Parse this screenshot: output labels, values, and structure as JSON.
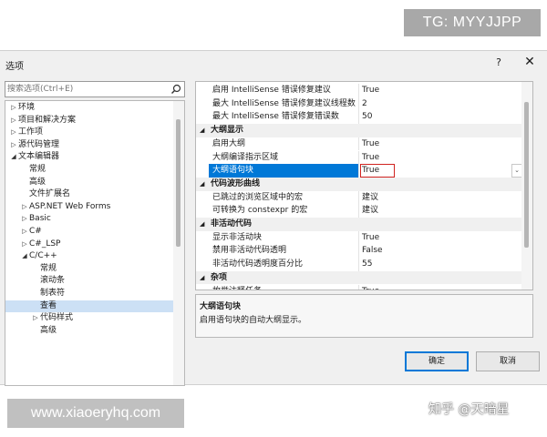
{
  "dialog": {
    "title": "选项",
    "help": "?",
    "close": "✕"
  },
  "search": {
    "placeholder": "搜索选项(Ctrl+E)",
    "value": ""
  },
  "tree": [
    {
      "label": "环境",
      "expander": "▷",
      "indent": 0
    },
    {
      "label": "项目和解决方案",
      "expander": "▷",
      "indent": 0
    },
    {
      "label": "工作项",
      "expander": "▷",
      "indent": 0
    },
    {
      "label": "源代码管理",
      "expander": "▷",
      "indent": 0
    },
    {
      "label": "文本编辑器",
      "expander": "◢",
      "indent": 0
    },
    {
      "label": "常规",
      "expander": "",
      "indent": 1
    },
    {
      "label": "高级",
      "expander": "",
      "indent": 1
    },
    {
      "label": "文件扩展名",
      "expander": "",
      "indent": 1
    },
    {
      "label": "ASP.NET Web Forms",
      "expander": "▷",
      "indent": 1
    },
    {
      "label": "Basic",
      "expander": "▷",
      "indent": 1
    },
    {
      "label": "C#",
      "expander": "▷",
      "indent": 1
    },
    {
      "label": "C#_LSP",
      "expander": "▷",
      "indent": 1
    },
    {
      "label": "C/C++",
      "expander": "◢",
      "indent": 1
    },
    {
      "label": "常规",
      "expander": "",
      "indent": 2
    },
    {
      "label": "滚动条",
      "expander": "",
      "indent": 2
    },
    {
      "label": "制表符",
      "expander": "",
      "indent": 2
    },
    {
      "label": "查看",
      "expander": "",
      "indent": 2,
      "selected": true
    },
    {
      "label": "代码样式",
      "expander": "▷",
      "indent": 2
    },
    {
      "label": "高级",
      "expander": "",
      "indent": 2
    }
  ],
  "properties": [
    {
      "kind": "prop",
      "name": "启用 IntelliSense 错误修复建议",
      "value": "True"
    },
    {
      "kind": "prop",
      "name": "最大 IntelliSense 错误修复建议线程数",
      "value": "2"
    },
    {
      "kind": "prop",
      "name": "最大 IntelliSense 错误修复错误数",
      "value": "50"
    },
    {
      "kind": "cat",
      "name": "大纲显示",
      "chevron": "◢"
    },
    {
      "kind": "prop",
      "name": "启用大纲",
      "value": "True"
    },
    {
      "kind": "prop",
      "name": "大纲编译指示区域",
      "value": "True"
    },
    {
      "kind": "prop",
      "name": "大纲语句块",
      "value": "True",
      "selected": true
    },
    {
      "kind": "cat",
      "name": "代码波形曲线",
      "chevron": "◢"
    },
    {
      "kind": "prop",
      "name": "已跳过的浏览区域中的宏",
      "value": "建议"
    },
    {
      "kind": "prop",
      "name": "可转换为 constexpr 的宏",
      "value": "建议"
    },
    {
      "kind": "cat",
      "name": "非活动代码",
      "chevron": "◢"
    },
    {
      "kind": "prop",
      "name": "显示非活动块",
      "value": "True"
    },
    {
      "kind": "prop",
      "name": "禁用非活动代码透明",
      "value": "False"
    },
    {
      "kind": "prop",
      "name": "非活动代码透明度百分比",
      "value": "55"
    },
    {
      "kind": "cat",
      "name": "杂项",
      "chevron": "◢"
    },
    {
      "kind": "prop",
      "name": "枚举注释任务",
      "value": "True"
    }
  ],
  "description": {
    "title": "大纲语句块",
    "text": "启用语句块的自动大纲显示。"
  },
  "buttons": {
    "ok": "确定",
    "cancel": "取消"
  },
  "watermarks": {
    "top": "TG: MYYJJPP",
    "bottom": "www.xiaoeryhq.com",
    "zhihu": "知乎 @天暗星"
  },
  "colors": {
    "selection": "#0078d7",
    "tree_selection": "#cce0f5",
    "highlight_box": "#d0231f"
  }
}
